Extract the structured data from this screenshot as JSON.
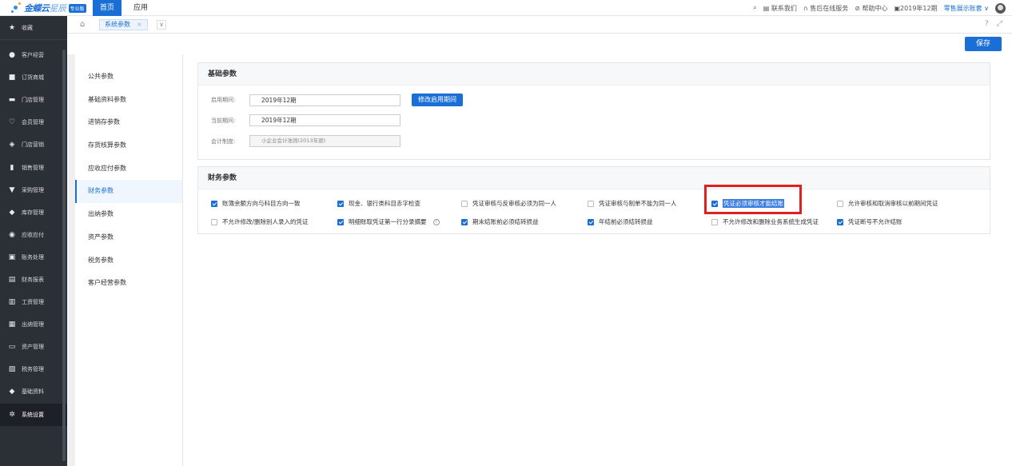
{
  "top": {
    "logo_main": "金蝶云",
    "logo_sub": "星辰",
    "edition": "专业版",
    "nav_home": "首页",
    "nav_app": "应用",
    "contact": "联系我们",
    "service": "售后在线服务",
    "help": "帮助中心",
    "period": "2019年12期",
    "account": "零售展示账套"
  },
  "sidebar": {
    "favorites": "收藏",
    "items": [
      {
        "label": "客户经营",
        "icon": "user-icon"
      },
      {
        "label": "订货商城",
        "icon": "store-icon"
      },
      {
        "label": "门店管理",
        "icon": "shop-icon"
      },
      {
        "label": "会员管理",
        "icon": "heart-icon"
      },
      {
        "label": "门店营销",
        "icon": "tag-icon"
      },
      {
        "label": "销售管理",
        "icon": "bar-chart-icon"
      },
      {
        "label": "采购管理",
        "icon": "cart-icon"
      },
      {
        "label": "库存管理",
        "icon": "box-icon"
      },
      {
        "label": "应收应付",
        "icon": "coin-icon"
      },
      {
        "label": "账务处理",
        "icon": "ledger-icon"
      },
      {
        "label": "财务报表",
        "icon": "report-icon"
      },
      {
        "label": "工资管理",
        "icon": "salary-icon"
      },
      {
        "label": "出纳管理",
        "icon": "cashier-icon"
      },
      {
        "label": "资产管理",
        "icon": "asset-icon"
      },
      {
        "label": "税务管理",
        "icon": "tax-icon"
      },
      {
        "label": "基础资料",
        "icon": "layers-icon"
      },
      {
        "label": "系统设置",
        "icon": "gear-icon"
      }
    ]
  },
  "tabs": {
    "active_tab": "系统参数",
    "close": "×",
    "more": "∨"
  },
  "toolbar": {
    "save_label": "保存"
  },
  "param_menu": [
    "公共参数",
    "基础资料参数",
    "进销存参数",
    "存货核算参数",
    "应收应付参数",
    "财务参数",
    "出纳参数",
    "资产参数",
    "税务参数",
    "客户经营参数"
  ],
  "basic": {
    "title": "基础参数",
    "start_label": "启用期间:",
    "start_value": "2019年12期",
    "modify_button": "修改启用期间",
    "current_label": "当前期间:",
    "current_value": "2019年12期",
    "standard_label": "会计制度:",
    "standard_value": "小企业会计准则(2013年颁)"
  },
  "finance": {
    "title": "财务参数",
    "options": [
      {
        "label": "账簿余额方向与科目方向一致",
        "checked": true
      },
      {
        "label": "现金、银行类科目赤字检查",
        "checked": true
      },
      {
        "label": "凭证审核与反审核必须为同一人",
        "checked": false
      },
      {
        "label": "凭证审核与制单不能为同一人",
        "checked": false
      },
      {
        "label": "凭证必须审核才能结账",
        "checked": true
      },
      {
        "label": "允许审核和取消审核以前期间凭证",
        "checked": false
      },
      {
        "label": "不允许修改/删除别人录入的凭证",
        "checked": false
      },
      {
        "label": "明细账取凭证第一行分录摘要",
        "checked": true
      },
      {
        "label": "期末结账前必须结转损益",
        "checked": true
      },
      {
        "label": "年结前必须结转损益",
        "checked": true
      },
      {
        "label": "不允许修改和删除业务系统生成凭证",
        "checked": false
      },
      {
        "label": "凭证断号不允许结账",
        "checked": true
      }
    ],
    "hint": "?"
  },
  "colors": {
    "accent": "#1a6fd6",
    "sidebar": "#2b2f36",
    "highlight_border": "#e02020"
  }
}
